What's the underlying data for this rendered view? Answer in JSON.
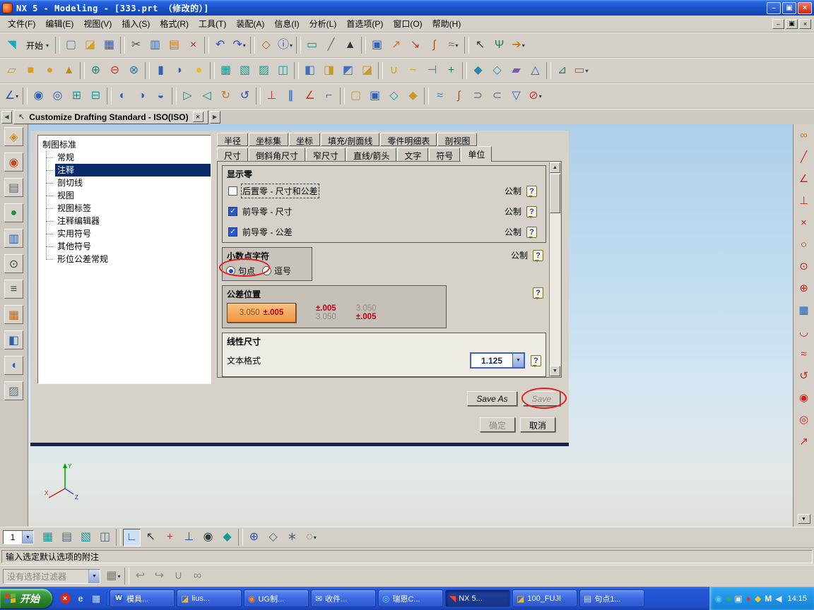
{
  "ui": {
    "help": "?",
    "up": "▲",
    "down": "▼",
    "left": "◀",
    "right": "▶",
    "close": "×",
    "min": "–",
    "restore": "▣",
    "dd": "▾",
    "cursor": "↖",
    "check": "✓"
  },
  "window": {
    "title": "NX 5 - Modeling - [333.prt （修改的）]",
    "menus": [
      "文件(F)",
      "编辑(E)",
      "视图(V)",
      "插入(S)",
      "格式(R)",
      "工具(T)",
      "装配(A)",
      "信息(I)",
      "分析(L)",
      "首选项(P)",
      "窗口(O)",
      "帮助(H)"
    ]
  },
  "dialog_tab": {
    "title": "Customize Drafting Standard - ISO(ISO)"
  },
  "toolbars": {
    "start_label": "开始",
    "row1": [
      {
        "n": "new-file-icon",
        "g": "▢",
        "c": "#5878b0"
      },
      {
        "n": "open-folder-icon",
        "g": "◪",
        "c": "#d8a020"
      },
      {
        "n": "save-icon",
        "g": "▦",
        "c": "#3858a8"
      },
      {
        "sep": true
      },
      {
        "n": "cut-icon",
        "g": "✂",
        "c": "#485058"
      },
      {
        "n": "copy-icon",
        "g": "▥",
        "c": "#3868b8"
      },
      {
        "n": "paste-icon",
        "g": "▤",
        "c": "#c87828"
      },
      {
        "n": "delete-icon",
        "g": "×",
        "c": "#c82818"
      },
      {
        "sep": true
      },
      {
        "n": "undo-icon",
        "g": "↶",
        "c": "#2850c0"
      },
      {
        "n": "redo-icon",
        "g": "↷",
        "c": "#2850c0",
        "arrow": true
      },
      {
        "sep": true
      },
      {
        "n": "screenshot-icon",
        "g": "◇",
        "c": "#b06818"
      },
      {
        "n": "info-icon",
        "g": "ⓘ",
        "c": "#2850c0",
        "arrow": true
      },
      {
        "sep": true
      },
      {
        "n": "measure-icon",
        "g": "▭",
        "c": "#188888"
      },
      {
        "n": "slope-icon",
        "g": "╱",
        "c": "#687078"
      },
      {
        "n": "chart-icon",
        "g": "▲",
        "c": "#283848"
      },
      {
        "sep": true
      },
      {
        "n": "window-icon",
        "g": "▣",
        "c": "#3060b8"
      },
      {
        "n": "export-icon",
        "g": "↗",
        "c": "#d87020"
      },
      {
        "n": "snap-view-icon",
        "g": "↘",
        "c": "#c83828"
      },
      {
        "n": "spline-icon",
        "g": "∫",
        "c": "#a85818"
      },
      {
        "n": "curve-icon",
        "g": "≈",
        "c": "#907848",
        "arrow": true
      },
      {
        "sep": true
      },
      {
        "n": "select-cursor-icon",
        "g": "↖",
        "c": "#303840"
      },
      {
        "n": "tree-browse-icon",
        "g": "Ψ",
        "c": "#208058"
      },
      {
        "n": "transform-icon",
        "g": "➔",
        "c": "#d07828",
        "arrow": true
      }
    ],
    "row2": [
      {
        "n": "datum-plane-icon",
        "g": "▱",
        "c": "#c89828"
      },
      {
        "n": "block-icon",
        "g": "■",
        "c": "#d8a020"
      },
      {
        "n": "cylinder-icon",
        "g": "●",
        "c": "#d8a020"
      },
      {
        "n": "cone-icon",
        "g": "▲",
        "c": "#c88818"
      },
      {
        "sep": true
      },
      {
        "n": "unite-icon",
        "g": "⊕",
        "c": "#188878"
      },
      {
        "n": "subtract-icon",
        "g": "⊖",
        "c": "#c83828"
      },
      {
        "n": "intersect-icon",
        "g": "⊗",
        "c": "#2878b8"
      },
      {
        "sep": true
      },
      {
        "n": "extrude-icon",
        "g": "▮",
        "c": "#3060c0"
      },
      {
        "n": "revolve-icon",
        "g": "◗",
        "c": "#3060c0"
      },
      {
        "n": "sphere-icon",
        "g": "●",
        "c": "#e8b828"
      },
      {
        "sep": true
      },
      {
        "n": "sheet-body-icon-1",
        "g": "▦",
        "c": "#189898"
      },
      {
        "n": "sheet-body-icon-2",
        "g": "▧",
        "c": "#189898"
      },
      {
        "n": "sheet-body-icon-3",
        "g": "▨",
        "c": "#189898"
      },
      {
        "n": "sheet-body-icon-4",
        "g": "◫",
        "c": "#189898"
      },
      {
        "sep": true
      },
      {
        "n": "feature-icon-1",
        "g": "◧",
        "c": "#4070c0"
      },
      {
        "n": "feature-icon-2",
        "g": "◨",
        "c": "#c89828"
      },
      {
        "n": "feature-icon-3",
        "g": "◩",
        "c": "#4070c0"
      },
      {
        "n": "feature-icon-4",
        "g": "◪",
        "c": "#c89828"
      },
      {
        "sep": true
      },
      {
        "n": "curve-tool-icon-1",
        "g": "∪",
        "c": "#c8a818"
      },
      {
        "n": "curve-tool-icon-2",
        "g": "~",
        "c": "#c8a818"
      },
      {
        "n": "trim-icon",
        "g": "⊣",
        "c": "#687078"
      },
      {
        "n": "join-icon",
        "g": "+",
        "c": "#208048"
      },
      {
        "sep": true
      },
      {
        "n": "surface-icon-1",
        "g": "◆",
        "c": "#2888a8"
      },
      {
        "n": "surface-icon-2",
        "g": "◇",
        "c": "#2888a8"
      },
      {
        "n": "surface-icon-3",
        "g": "▰",
        "c": "#7858b8"
      },
      {
        "n": "surface-icon-4",
        "g": "△",
        "c": "#3060c0"
      },
      {
        "sep": true
      },
      {
        "n": "sweep-icon",
        "g": "⊿",
        "c": "#188878"
      },
      {
        "n": "mesh-icon",
        "g": "▭",
        "c": "#906840",
        "arrow": true
      }
    ],
    "row3": [
      {
        "n": "sketch-icon",
        "g": "∠",
        "c": "#2850c0",
        "arrow": true
      },
      {
        "sep": true
      },
      {
        "n": "point-icon",
        "g": "◉",
        "c": "#2860c0"
      },
      {
        "n": "circle-icon",
        "g": "◎",
        "c": "#2860c0"
      },
      {
        "n": "grid-add-icon",
        "g": "⊞",
        "c": "#189898"
      },
      {
        "n": "grid-remove-icon",
        "g": "⊟",
        "c": "#189898"
      },
      {
        "sep": true
      },
      {
        "n": "shade-icon-1",
        "g": "◐",
        "c": "#3060b0"
      },
      {
        "n": "shade-icon-2",
        "g": "◑",
        "c": "#3060b0"
      },
      {
        "n": "shade-icon-3",
        "g": "◒",
        "c": "#3060b0"
      },
      {
        "sep": true
      },
      {
        "n": "play-icon",
        "g": "▷",
        "c": "#188878"
      },
      {
        "n": "back-icon",
        "g": "◁",
        "c": "#188878"
      },
      {
        "n": "rotate-cw-icon",
        "g": "↻",
        "c": "#c87828"
      },
      {
        "n": "rotate-ccw-icon",
        "g": "↺",
        "c": "#2850c0"
      },
      {
        "sep": true
      },
      {
        "n": "perpendicular-icon",
        "g": "⊥",
        "c": "#c83828"
      },
      {
        "n": "parallel-icon",
        "g": "∥",
        "c": "#2850c0"
      },
      {
        "n": "angle-icon",
        "g": "∠",
        "c": "#c83828"
      },
      {
        "n": "corner-icon",
        "g": "⌐",
        "c": "#687078"
      },
      {
        "sep": true
      },
      {
        "n": "hole-icon",
        "g": "▢",
        "c": "#c89828"
      },
      {
        "n": "pocket-icon",
        "g": "▣",
        "c": "#3060b8"
      },
      {
        "n": "pad-icon",
        "g": "◇",
        "c": "#189898"
      },
      {
        "n": "boss-icon",
        "g": "◆",
        "c": "#c89828"
      },
      {
        "sep": true
      },
      {
        "n": "blend-icon",
        "g": "≈",
        "c": "#2888a8"
      },
      {
        "n": "chamfer-icon",
        "g": "∫",
        "c": "#a85818"
      },
      {
        "n": "shell-icon",
        "g": "⊃",
        "c": "#687078"
      },
      {
        "n": "thread-icon",
        "g": "⊂",
        "c": "#687078"
      },
      {
        "n": "draft-icon",
        "g": "▽",
        "c": "#3060c0"
      },
      {
        "n": "patch-icon",
        "g": "⊘",
        "c": "#c83828",
        "arrow": true
      }
    ]
  },
  "left_rail": [
    {
      "n": "assembly-navigator-icon",
      "g": "◈",
      "c": "#c89020"
    },
    {
      "n": "constraint-navigator-icon",
      "g": "◉",
      "c": "#c04820"
    },
    {
      "n": "part-navigator-icon",
      "g": "▤",
      "c": "#586878"
    },
    {
      "n": "reuse-library-icon",
      "g": "●",
      "c": "#209048"
    },
    {
      "n": "hd3d-tools-icon",
      "g": "▥",
      "c": "#2860b0"
    },
    {
      "n": "history-icon",
      "g": "⊙",
      "c": "#404850"
    },
    {
      "n": "system-materials-icon",
      "g": "≡",
      "c": "#404850"
    },
    {
      "n": "process-studio-icon",
      "g": "▦",
      "c": "#c06828"
    },
    {
      "n": "manufacturing-wizard-icon",
      "g": "◧",
      "c": "#2860b0"
    },
    {
      "n": "roles-icon",
      "g": "◖",
      "c": "#3060b0"
    },
    {
      "n": "internet-browser-icon",
      "g": "▨",
      "c": "#607888"
    }
  ],
  "right_rail": [
    {
      "n": "link-constraint-icon",
      "g": "∞",
      "c": "#d87818"
    },
    {
      "n": "line-tool-icon",
      "g": "╱",
      "c": "#cc2418"
    },
    {
      "n": "angle-tool-icon",
      "g": "∠",
      "c": "#cc2418"
    },
    {
      "n": "perpendicular-tool-icon",
      "g": "⊥",
      "c": "#cc2418"
    },
    {
      "n": "cross-tool-icon",
      "g": "×",
      "c": "#cc2418"
    },
    {
      "n": "circle-tool-icon",
      "g": "○",
      "c": "#cc2418"
    },
    {
      "n": "concentric-tool-icon",
      "g": "⊙",
      "c": "#cc2418"
    },
    {
      "n": "tangent-tool-icon",
      "g": "⊕",
      "c": "#cc2418"
    },
    {
      "n": "grid-cube-icon",
      "g": "▦",
      "c": "#2860b0"
    },
    {
      "n": "arc-tool-icon",
      "g": "◡",
      "c": "#cc2418"
    },
    {
      "n": "curve-tool-icon",
      "g": "≈",
      "c": "#cc2418"
    },
    {
      "n": "rotate-tool-icon",
      "g": "↺",
      "c": "#cc2418"
    },
    {
      "n": "point-tool-icon",
      "g": "◉",
      "c": "#cc2418"
    },
    {
      "n": "target-tool-icon",
      "g": "◎",
      "c": "#cc2418"
    },
    {
      "n": "offset-tool-icon",
      "g": "↗",
      "c": "#cc2418"
    }
  ],
  "dialog": {
    "tree": {
      "root": "制图标准",
      "items": [
        {
          "label": "常规",
          "selected": false
        },
        {
          "label": "注释",
          "selected": true
        },
        {
          "label": "剖切线",
          "selected": false
        },
        {
          "label": "视图",
          "selected": false
        },
        {
          "label": "视图标签",
          "selected": false
        },
        {
          "label": "注释编辑器",
          "selected": false
        },
        {
          "label": "实用符号",
          "selected": false
        },
        {
          "label": "其他符号",
          "selected": false
        },
        {
          "label": "形位公差常规",
          "selected": false
        }
      ]
    },
    "tabs_row1": [
      {
        "label": "半径"
      },
      {
        "label": "坐标集"
      },
      {
        "label": "坐标"
      },
      {
        "label": "填充/剖面线"
      },
      {
        "label": "零件明细表"
      },
      {
        "label": "剖视图"
      }
    ],
    "tabs_row2": [
      {
        "label": "尺寸"
      },
      {
        "label": "倒斜角尺寸"
      },
      {
        "label": "窄尺寸"
      },
      {
        "label": "直线/箭头"
      },
      {
        "label": "文字"
      },
      {
        "label": "符号"
      },
      {
        "label": "单位",
        "active": true
      }
    ],
    "display_zero": {
      "title": "显示零",
      "options": [
        {
          "label": "后置零 - 尺寸和公差",
          "checked": false,
          "focused": true,
          "unit": "公制"
        },
        {
          "label": "前导零 - 尺寸",
          "checked": true,
          "unit": "公制"
        },
        {
          "label": "前导零 - 公差",
          "checked": true,
          "unit": "公制"
        }
      ]
    },
    "decimal_char": {
      "title": "小数点字符",
      "unit": "公制",
      "options": [
        {
          "label": "句点",
          "selected": true
        },
        {
          "label": "逗号",
          "selected": false
        }
      ]
    },
    "tolerance_position": {
      "title": "公差位置",
      "options": [
        {
          "main": "3.050",
          "tol": "±.005",
          "layout": "inline",
          "selected": true
        },
        {
          "main": "3.050",
          "tol": "±.005",
          "layout": "tol-top",
          "selected": false
        },
        {
          "main": "3.050",
          "tol": "±.005",
          "layout": "tol-bottom",
          "selected": false
        }
      ]
    },
    "linear_dim": {
      "title": "线性尺寸",
      "label": "文本格式",
      "value": "1.125"
    },
    "buttons": {
      "save_as": "Save As",
      "save": "Save",
      "ok": "确定",
      "cancel": "取消"
    }
  },
  "triad": {
    "x": "X",
    "y": "Y",
    "z": "Z"
  },
  "view_toolbar": {
    "combo_value": "1",
    "icons": [
      {
        "n": "layer-visible-icon",
        "g": "▦",
        "c": "#189898"
      },
      {
        "n": "layer-work-icon",
        "g": "▤",
        "c": "#586878"
      },
      {
        "n": "layer-category-icon",
        "g": "▧",
        "c": "#189898"
      },
      {
        "n": "layer-settings-icon",
        "g": "◫",
        "c": "#586878"
      },
      {
        "sep": true
      },
      {
        "n": "sketch-mode-icon",
        "g": "∟",
        "c": "#2850c0",
        "pressed": true
      },
      {
        "n": "select-cursor-icon",
        "g": "↖",
        "c": "#303840"
      },
      {
        "n": "snap-point-icon",
        "g": "+",
        "c": "#c83828"
      },
      {
        "n": "datum-axes-icon",
        "g": "⊥",
        "c": "#2850c0"
      },
      {
        "n": "origin-icon",
        "g": "◉",
        "c": "#303840"
      },
      {
        "n": "plane-icon",
        "g": "◆",
        "c": "#189898"
      },
      {
        "sep": true
      },
      {
        "n": "snap-circle-icon",
        "g": "⊕",
        "c": "#2850c0"
      },
      {
        "n": "snap-diamond-icon",
        "g": "◇",
        "c": "#586878"
      },
      {
        "n": "snap-end-icon",
        "g": "∗",
        "c": "#586878"
      },
      {
        "n": "snap-mid-icon",
        "g": "◌",
        "c": "#586878",
        "arrow": true
      }
    ]
  },
  "prompt_bar": {
    "text": "输入选定默认选项的附注"
  },
  "selection_bar": {
    "filter_placeholder": "没有选择过滤器",
    "icons": [
      {
        "n": "filter-grid-icon",
        "g": "▦",
        "c": "#807c74",
        "arrow": true
      },
      {
        "sep": true
      },
      {
        "n": "prev-selection-icon",
        "g": "↩",
        "c": "#8a8a82"
      },
      {
        "n": "next-selection-icon",
        "g": "↪",
        "c": "#8a8a82"
      },
      {
        "n": "magnet-icon",
        "g": "∪",
        "c": "#8a8a82"
      },
      {
        "n": "chain-selection-icon",
        "g": "∞",
        "c": "#8a8a82"
      }
    ]
  },
  "taskbar": {
    "start_label": "开始",
    "quick_launch": [
      {
        "n": "launch-stop-icon",
        "g": "×",
        "c": "#ffffff",
        "bg": "#d82818"
      },
      {
        "n": "internet-explorer-icon",
        "g": "e",
        "c": "#bcd8ff"
      },
      {
        "n": "show-desktop-icon",
        "g": "▦",
        "c": "#c8d8e8"
      }
    ],
    "tasks": [
      {
        "label": "模具...",
        "active": false,
        "icon": {
          "g": "W",
          "c": "#ffffff",
          "bg": "#2858c8"
        }
      },
      {
        "label": "lius...",
        "active": false,
        "icon": {
          "g": "◪",
          "c": "#e8b838"
        }
      },
      {
        "label": "UG制...",
        "active": false,
        "icon": {
          "g": "◉",
          "c": "#f08828"
        }
      },
      {
        "label": "收件...",
        "active": false,
        "icon": {
          "g": "✉",
          "c": "#e8ecf8"
        }
      },
      {
        "label": "瑞恩C...",
        "active": false,
        "icon": {
          "g": "◎",
          "c": "#78c8f0"
        }
      },
      {
        "label": "NX 5...",
        "active": true,
        "icon": {
          "g": "◥",
          "c": "#f04828"
        }
      },
      {
        "label": "100_FUJI",
        "active": false,
        "icon": {
          "g": "◪",
          "c": "#e8b838"
        }
      },
      {
        "label": "句点1...",
        "active": false,
        "icon": {
          "g": "▤",
          "c": "#d8dce8"
        }
      }
    ],
    "tray_icons": [
      {
        "n": "tray-icon-1",
        "g": "◉",
        "c": "#58c8f8"
      },
      {
        "n": "tray-icon-2",
        "g": "●",
        "c": "#38b048"
      },
      {
        "n": "tray-icon-3",
        "g": "▣",
        "c": "#e8e8e8"
      },
      {
        "n": "tray-icon-4",
        "g": "●",
        "c": "#e83828"
      },
      {
        "n": "tray-icon-5",
        "g": "◆",
        "c": "#f0c838"
      },
      {
        "n": "tray-icon-6",
        "g": "M",
        "c": "#f8f8f8"
      },
      {
        "n": "volume-icon",
        "g": "◀",
        "c": "#e8e8e8"
      }
    ],
    "tray_time": "14:15"
  }
}
